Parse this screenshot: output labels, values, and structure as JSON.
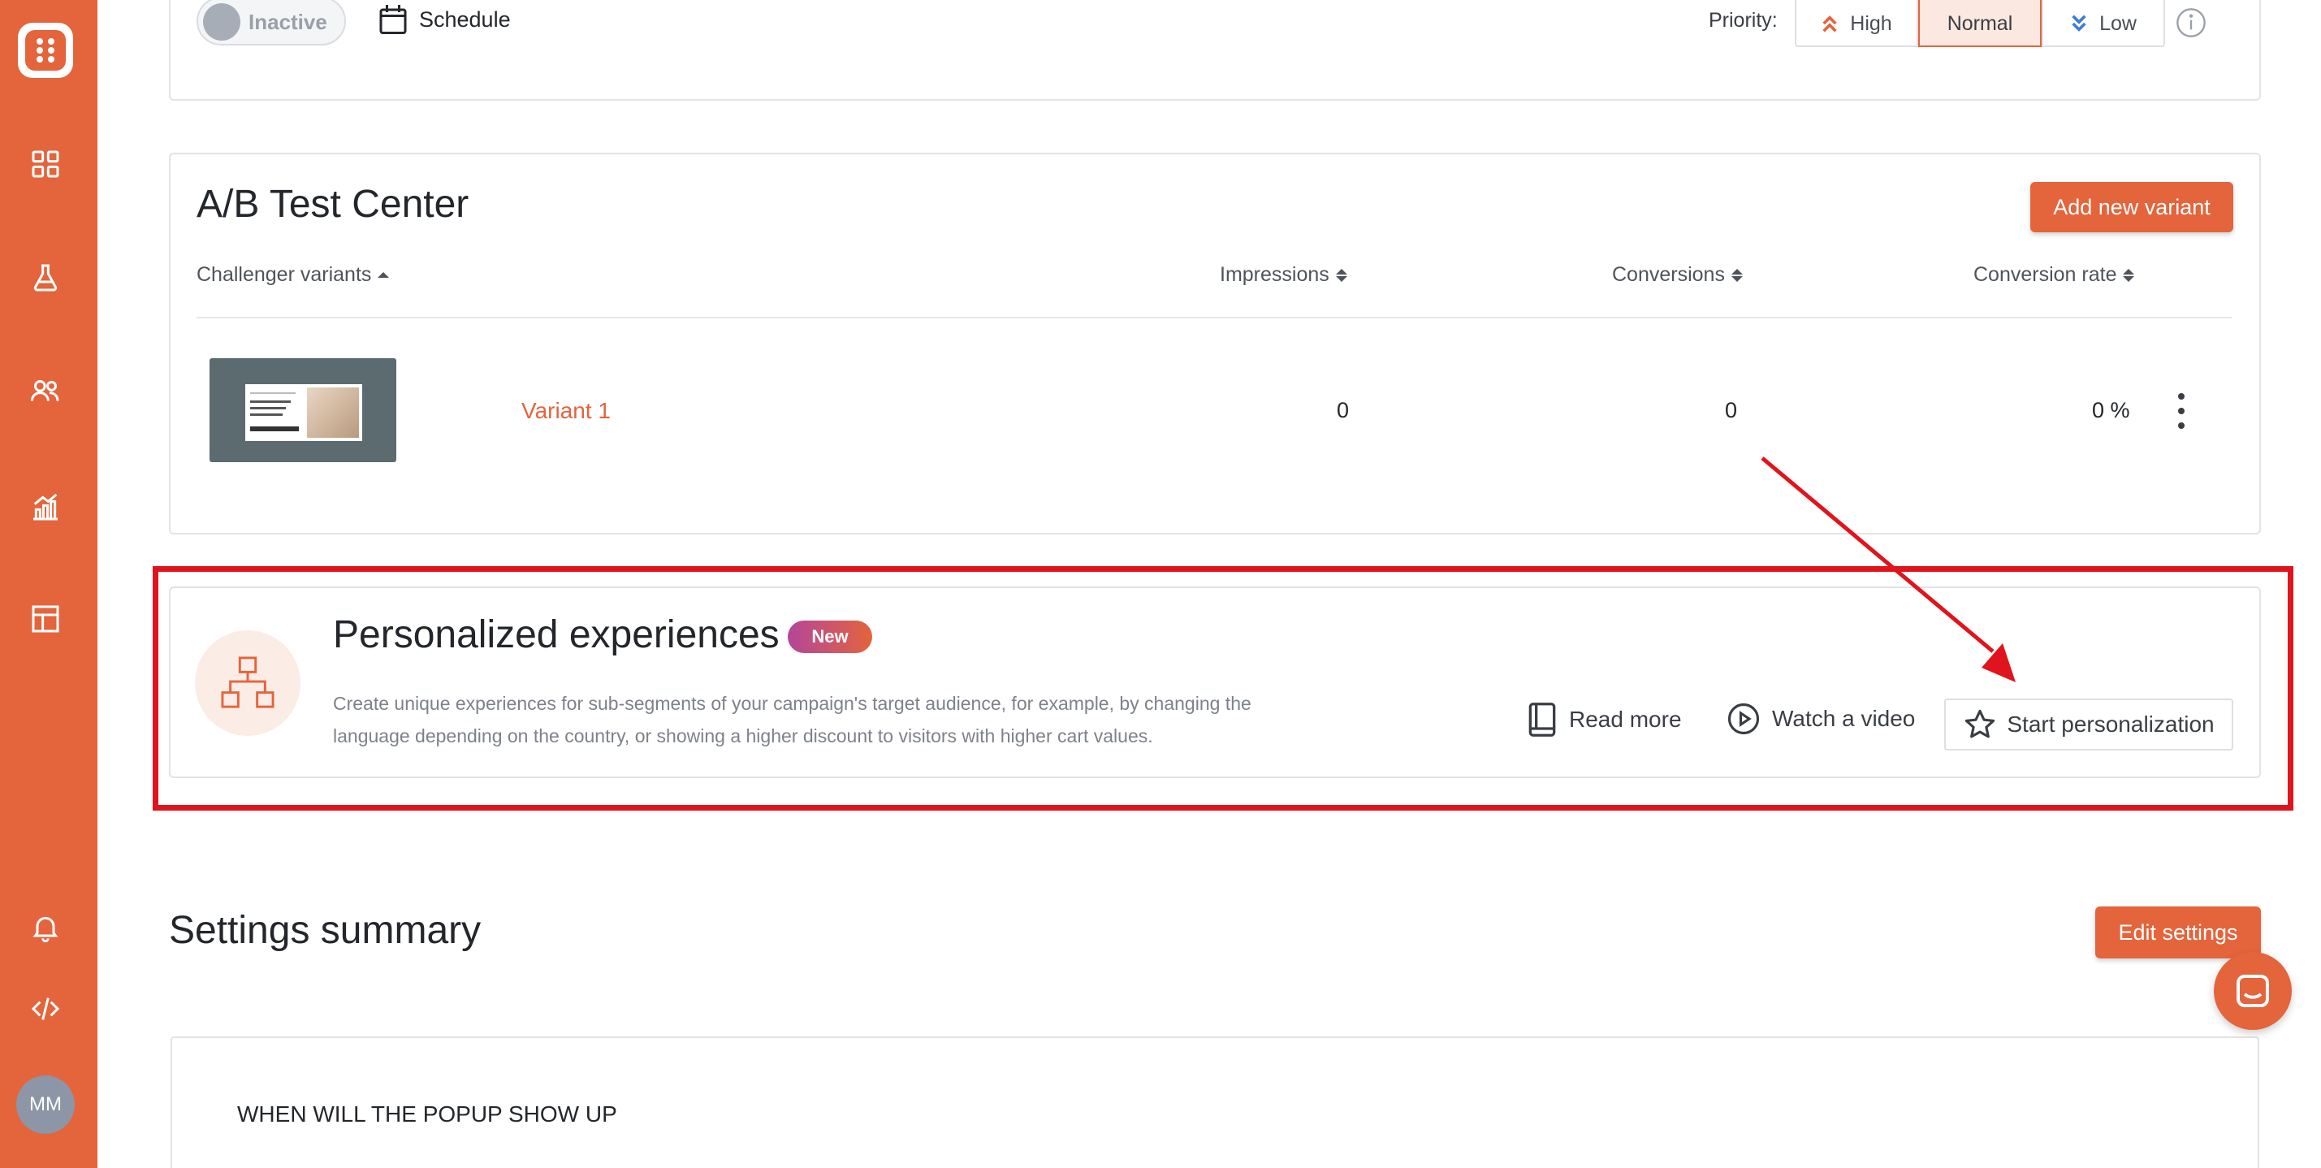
{
  "top_bar": {
    "status_toggle_label": "Inactive",
    "schedule_label": "Schedule",
    "priority_label": "Priority:",
    "priority_options": [
      {
        "label": "High",
        "icon": "double-chevron-up-icon"
      },
      {
        "label": "Normal"
      },
      {
        "label": "Low",
        "icon": "double-chevron-down-icon"
      }
    ],
    "priority_selected": "Normal"
  },
  "ab_test": {
    "title": "A/B Test Center",
    "add_button_label": "Add new variant",
    "columns": {
      "variants": "Challenger variants",
      "impressions": "Impressions",
      "conversions": "Conversions",
      "conversion_rate": "Conversion rate"
    },
    "rows": [
      {
        "name": "Variant 1",
        "impressions": "0",
        "conversions": "0",
        "conversion_rate": "0 %"
      }
    ]
  },
  "personalized": {
    "title": "Personalized experiences",
    "badge": "New",
    "description": "Create unique experiences for sub-segments of your campaign's target audience, for example, by changing the language depending on the country, or showing a higher discount to visitors with higher cart values.",
    "read_more_label": "Read more",
    "watch_video_label": "Watch a video",
    "start_label": "Start personalization"
  },
  "settings_summary": {
    "title": "Settings summary",
    "edit_button_label": "Edit settings",
    "section_heading": "WHEN WILL THE POPUP SHOW UP"
  },
  "sidebar": {
    "avatar_initials": "MM",
    "icons": [
      "logo-icon",
      "dashboard-grid-icon",
      "flask-icon",
      "users-icon",
      "analytics-chart-icon",
      "layout-template-icon",
      "bell-icon",
      "code-icon"
    ]
  },
  "colors": {
    "accent": "#e4643c",
    "highlight_frame": "#e0141c",
    "selected_priority_bg": "#fbe8e1"
  }
}
